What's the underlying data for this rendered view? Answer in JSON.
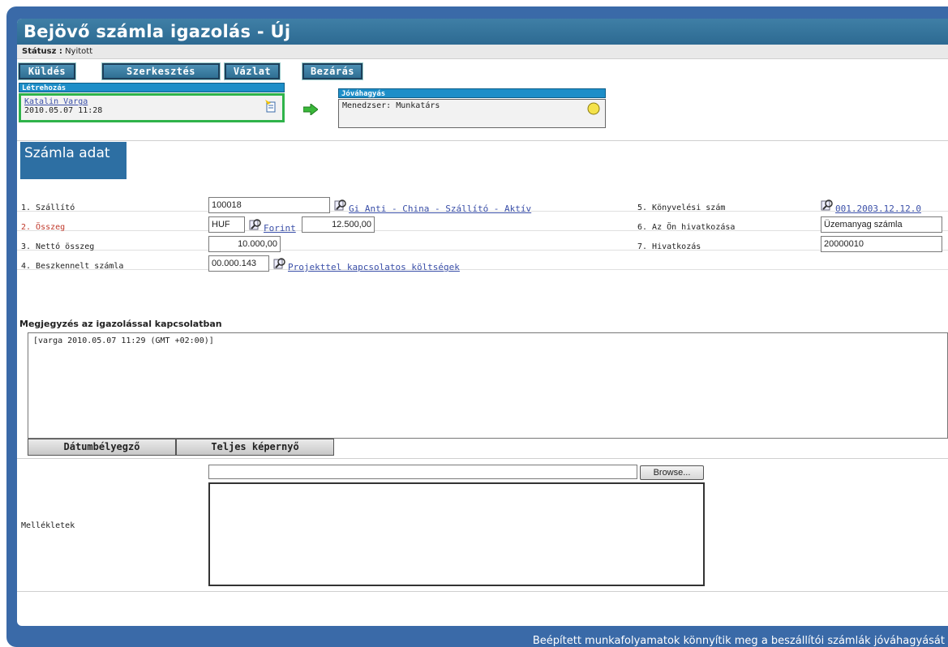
{
  "window": {
    "title": "Bejövő számla igazolás - Új"
  },
  "status": {
    "label": "Státusz :",
    "value": "Nyitott"
  },
  "toolbar": {
    "send": "Küldés",
    "edit": "Szerkesztés",
    "draft": "Vázlat",
    "close": "Bezárás"
  },
  "workflow": {
    "creation": {
      "header": "Létrehozás",
      "user": "Katalin Varga",
      "datetime": "2010.05.07 11:28"
    },
    "approval": {
      "header": "Jóváhagyás",
      "text": "Menedzser: Munkatárs"
    }
  },
  "section": {
    "title": "Számla adat"
  },
  "form": {
    "supplier": {
      "label": "1. Szállító",
      "value": "100018",
      "link": "Gi Anti - China - Szállító - Aktív"
    },
    "amount": {
      "label": "2. Összeg",
      "currency": "HUF",
      "currency_link": "Forint",
      "value": "12.500,00"
    },
    "net_amount": {
      "label": "3. Nettó összeg",
      "value": "10.000,00"
    },
    "scanned_invoice": {
      "label": "4. Beszkennelt számla",
      "value": "00.000.143",
      "link": "Projekttel kapcsolatos költségek"
    },
    "accounting_number": {
      "label": "5. Könyvelési szám",
      "link": "001.2003.12.12.0"
    },
    "your_reference": {
      "label": "6. Az Ön hivatkozása",
      "value": "Üzemanyag számla"
    },
    "reference": {
      "label": "7. Hivatkozás",
      "value": "20000010"
    }
  },
  "notes": {
    "label": "Megjegyzés az igazolással kapcsolatban",
    "content": "[varga 2010.05.07 11:29 (GMT +02:00)]",
    "timestamp_button": "Dátumbélyegző",
    "fullscreen_button": "Teljes képernyő"
  },
  "attachments": {
    "label": "Mellékletek",
    "browse_button": "Browse..."
  },
  "caption": "Beépített munkafolyamatok könnyítik meg a beszállítói számlák jóváhagyását",
  "colors": {
    "frame": "#3a6aa8",
    "titlebar": "#2d6a92",
    "workflow_header": "#1d8ec8",
    "creation_border": "#2fb34a"
  }
}
